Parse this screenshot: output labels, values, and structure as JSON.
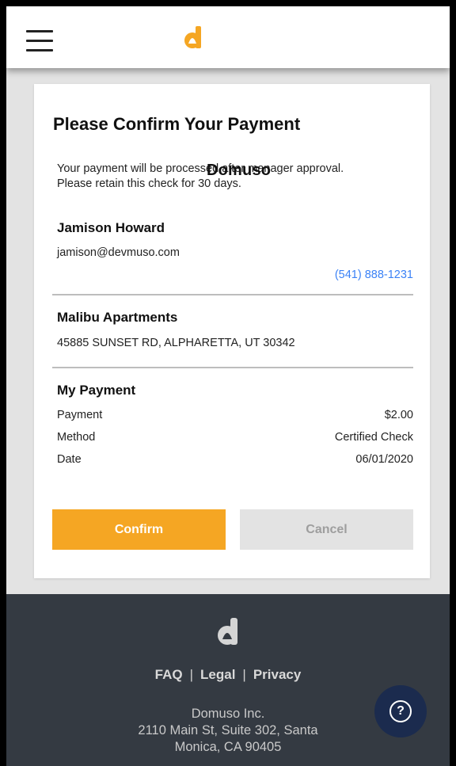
{
  "header": {
    "brand_name": "Domuso"
  },
  "card": {
    "title": "Please Confirm Your Payment",
    "notice_line1": "Your payment will be processed after manager approval.",
    "notice_line2": "Please retain this check for 30 days.",
    "resident": {
      "name": "Jamison Howard",
      "email": "jamison@devmuso.com",
      "phone": "(541) 888-1231"
    },
    "property": {
      "name": "Malibu Apartments",
      "address": "45885 SUNSET RD, ALPHARETTA, UT 30342"
    },
    "payment": {
      "title": "My Payment",
      "rows": [
        {
          "label": "Payment",
          "value": "$2.00"
        },
        {
          "label": "Method",
          "value": "Certified Check"
        },
        {
          "label": "Date",
          "value": "06/01/2020"
        }
      ]
    },
    "buttons": {
      "confirm": "Confirm",
      "cancel": "Cancel"
    }
  },
  "footer": {
    "links": [
      "FAQ",
      "Legal",
      "Privacy"
    ],
    "separator": "|",
    "company": "Domuso Inc.",
    "address_line1": "2110 Main St, Suite 302, Santa",
    "address_line2": "Monica, CA 90405"
  },
  "help_button": {
    "icon": "question-icon",
    "glyph": "?"
  },
  "colors": {
    "accent": "#f5a623",
    "link": "#3b82f6",
    "footer_bg": "#343a42",
    "help_bg": "#1b2b4e"
  }
}
